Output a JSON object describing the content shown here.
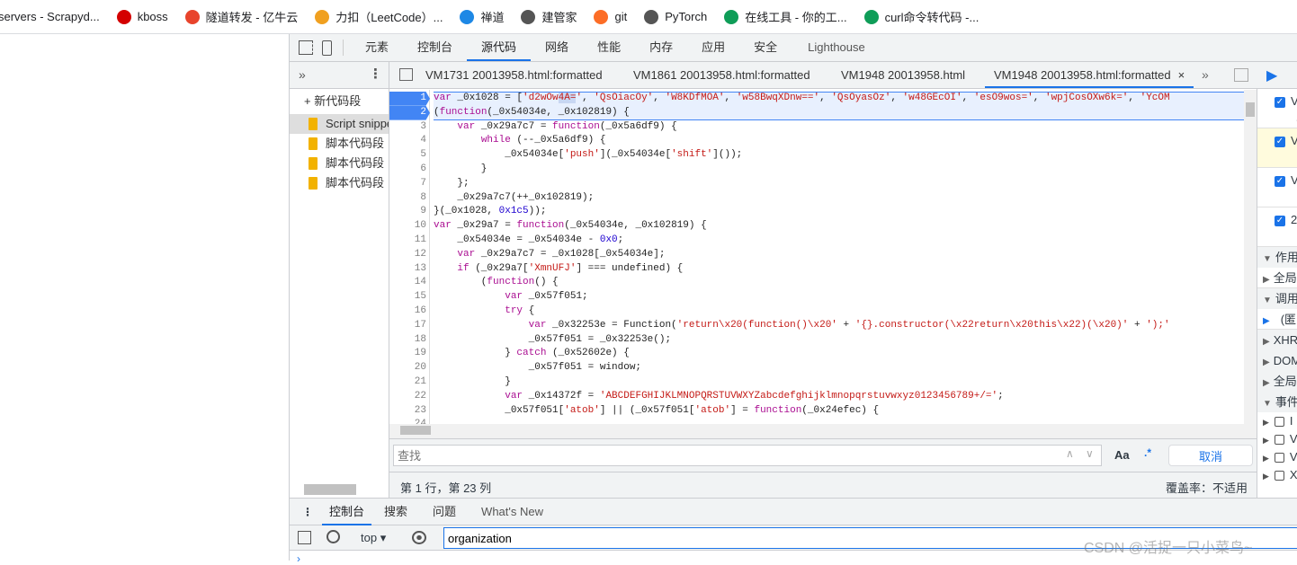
{
  "bookmarks": [
    {
      "label": "servers - Scrapyd...",
      "icon": "none",
      "color": ""
    },
    {
      "label": "kboss",
      "icon": "k-logo-icon",
      "color": "#d40000"
    },
    {
      "label": "隧道转发 - 亿牛云",
      "icon": "yiniuyun-icon",
      "color": "#e8442c"
    },
    {
      "label": "力扣（LeetCode）...",
      "icon": "leetcode-icon",
      "color": "#f0a020"
    },
    {
      "label": "禅道",
      "icon": "zentao-icon",
      "color": "#1e88e5"
    },
    {
      "label": "建管家",
      "icon": "globe-icon",
      "color": "#555"
    },
    {
      "label": "git",
      "icon": "gitlab-icon",
      "color": "#fc6d26"
    },
    {
      "label": "PyTorch",
      "icon": "globe-icon",
      "color": "#555"
    },
    {
      "label": "在线工具 - 你的工...",
      "icon": "tool-icon",
      "color": "#0f9d58"
    },
    {
      "label": "curl命令转代码 -...",
      "icon": "tool-icon",
      "color": "#0f9d58"
    }
  ],
  "devtools": {
    "tabs": [
      "元素",
      "控制台",
      "源代码",
      "网络",
      "性能",
      "内存",
      "应用",
      "安全",
      "Lighthouse"
    ],
    "active_tab": "源代码",
    "source_tabs": [
      "VM1731 20013958.html:formatted",
      "VM1861 20013958.html:formatted",
      "VM1948 20013958.html",
      "VM1948 20013958.html:formatted"
    ],
    "active_source_tab": 3,
    "navigator": {
      "new_snippet": "+ 新代码段",
      "items": [
        "Script snippet",
        "脚本代码段",
        "脚本代码段",
        "脚本代码段"
      ]
    },
    "code_lines": [
      [
        [
          "k",
          "var"
        ],
        [
          "p",
          " _0x1028 = ["
        ],
        [
          "s",
          "'d2wOw"
        ],
        [
          "ss",
          "4A="
        ],
        [
          "s",
          "'"
        ],
        [
          "p",
          ", "
        ],
        [
          "s",
          "'QsOiacOy'"
        ],
        [
          "p",
          ", "
        ],
        [
          "s",
          "'W8KDfMOA'"
        ],
        [
          "p",
          ", "
        ],
        [
          "s",
          "'w58BwqXDnw=='"
        ],
        [
          "p",
          ", "
        ],
        [
          "s",
          "'QsOyasOz'"
        ],
        [
          "p",
          ", "
        ],
        [
          "s",
          "'w48GEcOI'"
        ],
        [
          "p",
          ", "
        ],
        [
          "s",
          "'esO9wos='"
        ],
        [
          "p",
          ", "
        ],
        [
          "s",
          "'wpjCosOXw6k='"
        ],
        [
          "p",
          ", "
        ],
        [
          "s",
          "'YcOM"
        ]
      ],
      [
        [
          "p",
          "("
        ],
        [
          "k",
          "function"
        ],
        [
          "p",
          "(_0x54034e, _0x102819) {"
        ]
      ],
      [
        [
          "p",
          "    "
        ],
        [
          "k",
          "var"
        ],
        [
          "p",
          " _0x29a7c7 = "
        ],
        [
          "k",
          "function"
        ],
        [
          "p",
          "(_0x5a6df9) {"
        ]
      ],
      [
        [
          "p",
          "        "
        ],
        [
          "k",
          "while"
        ],
        [
          "p",
          " (--_0x5a6df9) {"
        ]
      ],
      [
        [
          "p",
          "            _0x54034e["
        ],
        [
          "s",
          "'push'"
        ],
        [
          "p",
          "](_0x54034e["
        ],
        [
          "s",
          "'shift'"
        ],
        [
          "p",
          "]());"
        ]
      ],
      [
        [
          "p",
          "        }"
        ]
      ],
      [
        [
          "p",
          "    };"
        ]
      ],
      [
        [
          "p",
          "    _0x29a7c7(++_0x102819);"
        ]
      ],
      [
        [
          "p",
          "}(_0x1028, "
        ],
        [
          "n",
          "0x1c5"
        ],
        [
          "p",
          "));"
        ]
      ],
      [
        [
          "k",
          "var"
        ],
        [
          "p",
          " _0x29a7 = "
        ],
        [
          "k",
          "function"
        ],
        [
          "p",
          "(_0x54034e, _0x102819) {"
        ]
      ],
      [
        [
          "p",
          "    _0x54034e = _0x54034e - "
        ],
        [
          "n",
          "0x0"
        ],
        [
          "p",
          ";"
        ]
      ],
      [
        [
          "p",
          "    "
        ],
        [
          "k",
          "var"
        ],
        [
          "p",
          " _0x29a7c7 = _0x1028[_0x54034e];"
        ]
      ],
      [
        [
          "p",
          "    "
        ],
        [
          "k",
          "if"
        ],
        [
          "p",
          " (_0x29a7["
        ],
        [
          "s",
          "'XmnUFJ'"
        ],
        [
          "p",
          "] === undefined) {"
        ]
      ],
      [
        [
          "p",
          "        ("
        ],
        [
          "k",
          "function"
        ],
        [
          "p",
          "() {"
        ]
      ],
      [
        [
          "p",
          "            "
        ],
        [
          "k",
          "var"
        ],
        [
          "p",
          " _0x57f051;"
        ]
      ],
      [
        [
          "p",
          "            "
        ],
        [
          "k",
          "try"
        ],
        [
          "p",
          " {"
        ]
      ],
      [
        [
          "p",
          "                "
        ],
        [
          "k",
          "var"
        ],
        [
          "p",
          " _0x32253e = Function("
        ],
        [
          "s",
          "'return\\x20(function()\\x20'"
        ],
        [
          "p",
          " + "
        ],
        [
          "s",
          "'{}.constructor(\\x22return\\x20this\\x22)(\\x20)'"
        ],
        [
          "p",
          " + "
        ],
        [
          "s",
          "');'"
        ]
      ],
      [
        [
          "p",
          "                _0x57f051 = _0x32253e();"
        ]
      ],
      [
        [
          "p",
          "            } "
        ],
        [
          "k",
          "catch"
        ],
        [
          "p",
          " (_0x52602e) {"
        ]
      ],
      [
        [
          "p",
          "                _0x57f051 = window;"
        ]
      ],
      [
        [
          "p",
          "            }"
        ]
      ],
      [
        [
          "p",
          "            "
        ],
        [
          "k",
          "var"
        ],
        [
          "p",
          " _0x14372f = "
        ],
        [
          "s",
          "'ABCDEFGHIJKLMNOPQRSTUVWXYZabcdefghijklmnopqrstuvwxyz0123456789+/='"
        ],
        [
          "p",
          ";"
        ]
      ],
      [
        [
          "p",
          "            _0x57f051["
        ],
        [
          "s",
          "'atob'"
        ],
        [
          "p",
          "] || (_0x57f051["
        ],
        [
          "s",
          "'atob'"
        ],
        [
          "p",
          "] = "
        ],
        [
          "k",
          "function"
        ],
        [
          "p",
          "(_0x24efec) {"
        ]
      ]
    ],
    "search": {
      "placeholder": "查找",
      "match_case": "Aa",
      "regex": ".*",
      "cancel": "取消"
    },
    "status": {
      "position": "第 1 行，第 23 列",
      "coverage": "覆盖率：不适用"
    },
    "right_panel": {
      "breakpoints": [
        [
          "V",
          "_"
        ],
        [
          "V",
          "v"
        ],
        [
          "V",
          "("
        ],
        [
          "2",
          "d"
        ]
      ],
      "sections": [
        "作用",
        "全局",
        "调用",
        "(匿",
        "XHR",
        "DOM",
        "全局",
        "事件"
      ],
      "listeners": [
        "I",
        "V",
        "V",
        "X"
      ]
    }
  },
  "drawer": {
    "tabs": [
      "控制台",
      "搜索",
      "问题",
      "What's New"
    ],
    "active_tab": "控制台",
    "context": "top",
    "filter_value": "organization"
  },
  "watermark": "CSDN @活捉一只小菜鸟~",
  "colors": {
    "accent": "#1a73e8",
    "keyword": "#aa0d91",
    "string": "#c41a16",
    "number": "#1c00cf"
  }
}
